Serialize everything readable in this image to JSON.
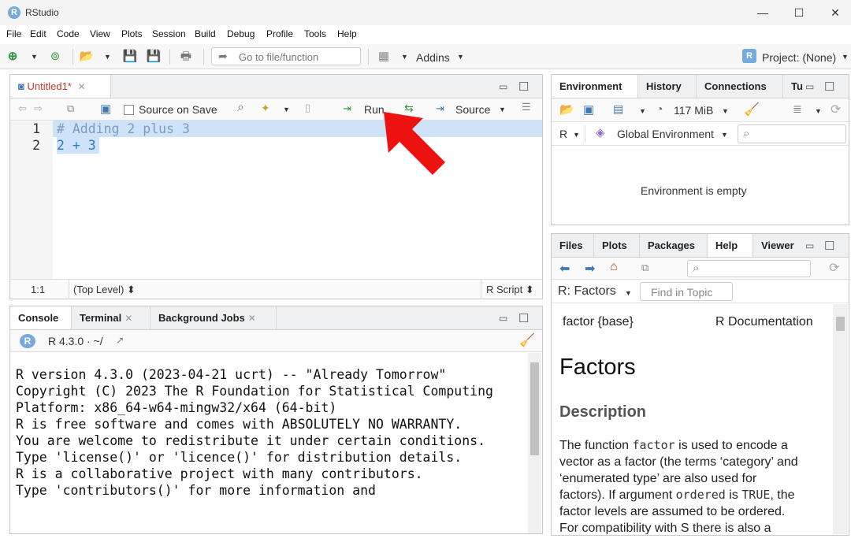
{
  "window": {
    "title": "RStudio",
    "app_icon_letter": "R"
  },
  "menu": [
    "File",
    "Edit",
    "Code",
    "View",
    "Plots",
    "Session",
    "Build",
    "Debug",
    "Profile",
    "Tools",
    "Help"
  ],
  "toolbar": {
    "goto_placeholder": "Go to file/function",
    "addins_label": "Addins",
    "project_label": "Project: (None)"
  },
  "editor": {
    "tab_label": "Untitled1*",
    "source_on_save_label": "Source on Save",
    "run_label": "Run",
    "source_label": "Source",
    "lines": [
      {
        "number": "1",
        "text": "# Adding 2 plus 3"
      },
      {
        "number": "2",
        "text": "2 + 3"
      }
    ],
    "status_position": "1:1",
    "status_scope": "(Top Level) ⬍",
    "status_type": "R Script ⬍"
  },
  "console": {
    "tabs": [
      "Console",
      "Terminal",
      "Background Jobs"
    ],
    "r_version_label": "R 4.3.0 · ~/",
    "lines": [
      "R version 4.3.0 (2023-04-21 ucrt) -- \"Already Tomorrow\"",
      "Copyright (C) 2023 The R Foundation for Statistical Computing",
      "Platform: x86_64-w64-mingw32/x64 (64-bit)",
      "",
      "R is free software and comes with ABSOLUTELY NO WARRANTY.",
      "You are welcome to redistribute it under certain conditions.",
      "Type 'license()' or 'licence()' for distribution details.",
      "",
      "R is a collaborative project with many contributors.",
      "Type 'contributors()' for more information and"
    ]
  },
  "environment": {
    "tabs": [
      "Environment",
      "History",
      "Connections",
      "Tu"
    ],
    "memory_label": "117 MiB",
    "r_label": "R",
    "scope_label": "Global Environment",
    "empty_message": "Environment is empty"
  },
  "help": {
    "tabs": [
      "Files",
      "Plots",
      "Packages",
      "Help",
      "Viewer"
    ],
    "topic_label": "R: Factors",
    "find_placeholder": "Find in Topic",
    "doc_left": "factor {base}",
    "doc_right": "R Documentation",
    "heading": "Factors",
    "subheading": "Description",
    "body_lines": [
      [
        "The function ",
        "factor",
        " is used to encode a"
      ],
      [
        "vector as a factor (the terms ‘category’ and"
      ],
      [
        "‘enumerated type’ are also used for"
      ],
      [
        "factors). If argument ",
        "ordered",
        " is ",
        "TRUE",
        ", the"
      ],
      [
        "factor levels are assumed to be ordered."
      ],
      [
        "For compatibility with S there is also a"
      ]
    ]
  },
  "colors": {
    "accent_blue": "#75aadb",
    "selection": "#cfe3f8",
    "arrow_red": "#ee1111",
    "run_green": "#2f9b3c"
  }
}
